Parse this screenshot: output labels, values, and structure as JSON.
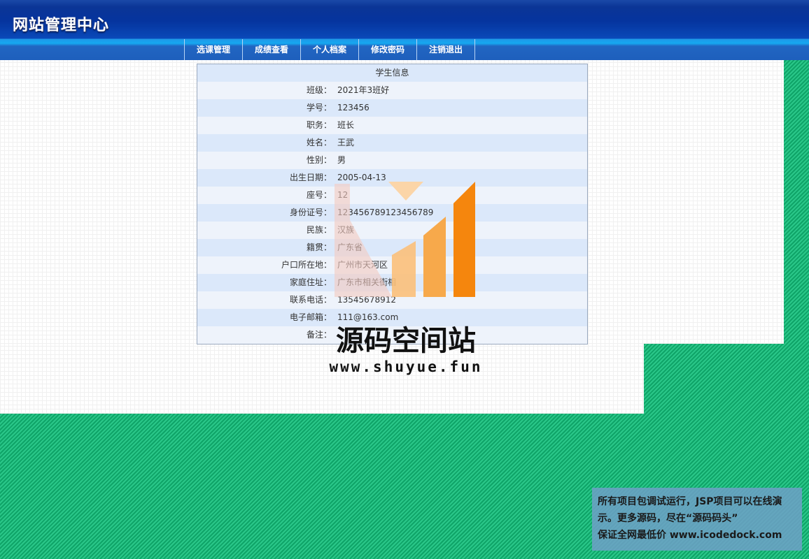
{
  "header": {
    "logo_text": "网站管理中心"
  },
  "nav": {
    "items": [
      {
        "label": "选课管理"
      },
      {
        "label": "成绩查看"
      },
      {
        "label": "个人档案"
      },
      {
        "label": "修改密码"
      },
      {
        "label": "注销退出"
      }
    ]
  },
  "student_info": {
    "title": "学生信息",
    "rows": [
      {
        "label": "班级：",
        "value": "2021年3班好"
      },
      {
        "label": "学号：",
        "value": "123456"
      },
      {
        "label": "职务：",
        "value": "班长"
      },
      {
        "label": "姓名：",
        "value": "王武"
      },
      {
        "label": "性别：",
        "value": "男"
      },
      {
        "label": "出生日期：",
        "value": "2005-04-13"
      },
      {
        "label": "座号：",
        "value": "12"
      },
      {
        "label": "身份证号：",
        "value": "123456789123456789"
      },
      {
        "label": "民族：",
        "value": "汉族"
      },
      {
        "label": "籍贯：",
        "value": "广东省"
      },
      {
        "label": "户口所在地：",
        "value": "广州市天河区"
      },
      {
        "label": "家庭住址：",
        "value": "广东市相关街相"
      },
      {
        "label": "联系电话：",
        "value": "13545678912"
      },
      {
        "label": "电子邮箱：",
        "value": "111@163.com"
      },
      {
        "label": "备注：",
        "value": ""
      }
    ]
  },
  "watermark": {
    "title": "源码空间站",
    "url": "www.shuyue.fun",
    "colors": {
      "bar_light": "#fbd5a8",
      "bar_mid": "#f7a94b",
      "bar_dark": "#f5860d",
      "pink": "#f4c9c0"
    }
  },
  "ad": {
    "line1": "所有项目包调试运行，JSP项目可以在线演示。更多源码，尽在“源码码头”",
    "line2": "保证全网最低价 www.icodedock.com"
  }
}
